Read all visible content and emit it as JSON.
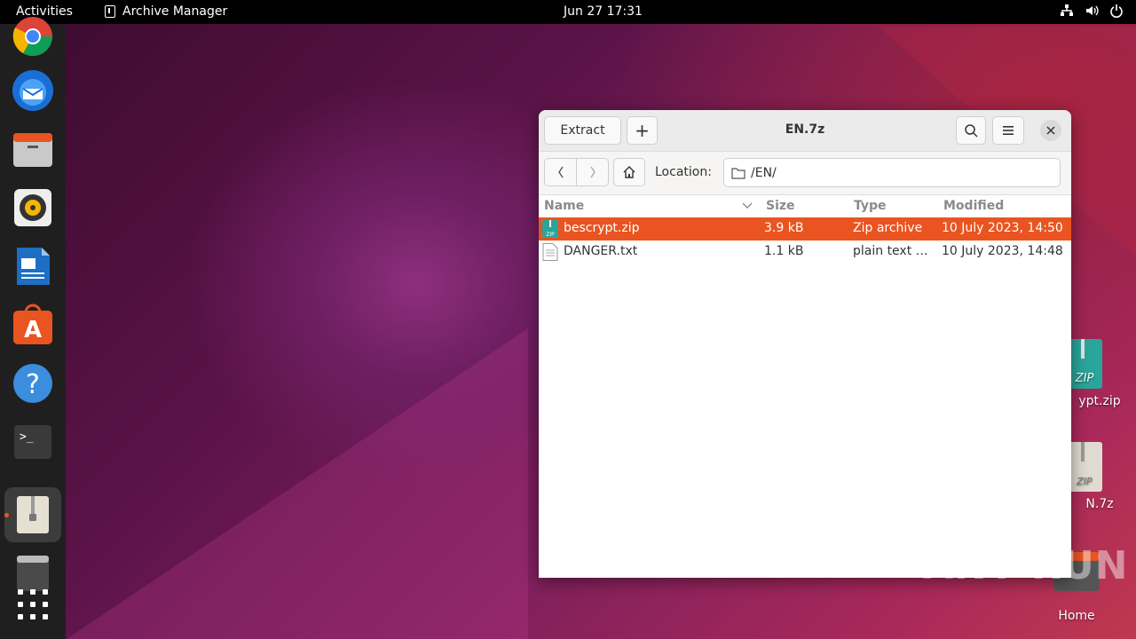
{
  "topbar": {
    "activities": "Activities",
    "app_name": "Archive Manager",
    "clock": "Jun 27  17:31"
  },
  "dock": {
    "items": [
      "chrome-icon",
      "thunderbird-icon",
      "files-icon",
      "rhythmbox-icon",
      "writer-icon",
      "app-center-icon",
      "help-icon",
      "terminal-icon",
      "archive-manager-icon",
      "trash-icon",
      "app-grid-icon"
    ]
  },
  "desktop": {
    "icons": [
      {
        "label": "ypt.zip"
      },
      {
        "label": "N.7z"
      },
      {
        "label": "Home"
      }
    ]
  },
  "window": {
    "title": "EN.7z",
    "extract_label": "Extract",
    "add_label": "+",
    "location_label": "Location:",
    "location_value": "/EN/",
    "columns": {
      "name": "Name",
      "size": "Size",
      "type": "Type",
      "modified": "Modified"
    },
    "rows": [
      {
        "name": "bescrypt.zip",
        "size": "3.9 kB",
        "type": "Zip archive",
        "modified": "10 July 2023, 14:50",
        "selected": true
      },
      {
        "name": "DANGER.txt",
        "size": "1.1 kB",
        "type": "plain text …",
        "modified": "10 July 2023, 14:48",
        "selected": false
      }
    ]
  },
  "watermark": "ANY RUN",
  "colors": {
    "accent": "#e95420",
    "topbar": "#000000",
    "dock": "#1f1f1f"
  }
}
